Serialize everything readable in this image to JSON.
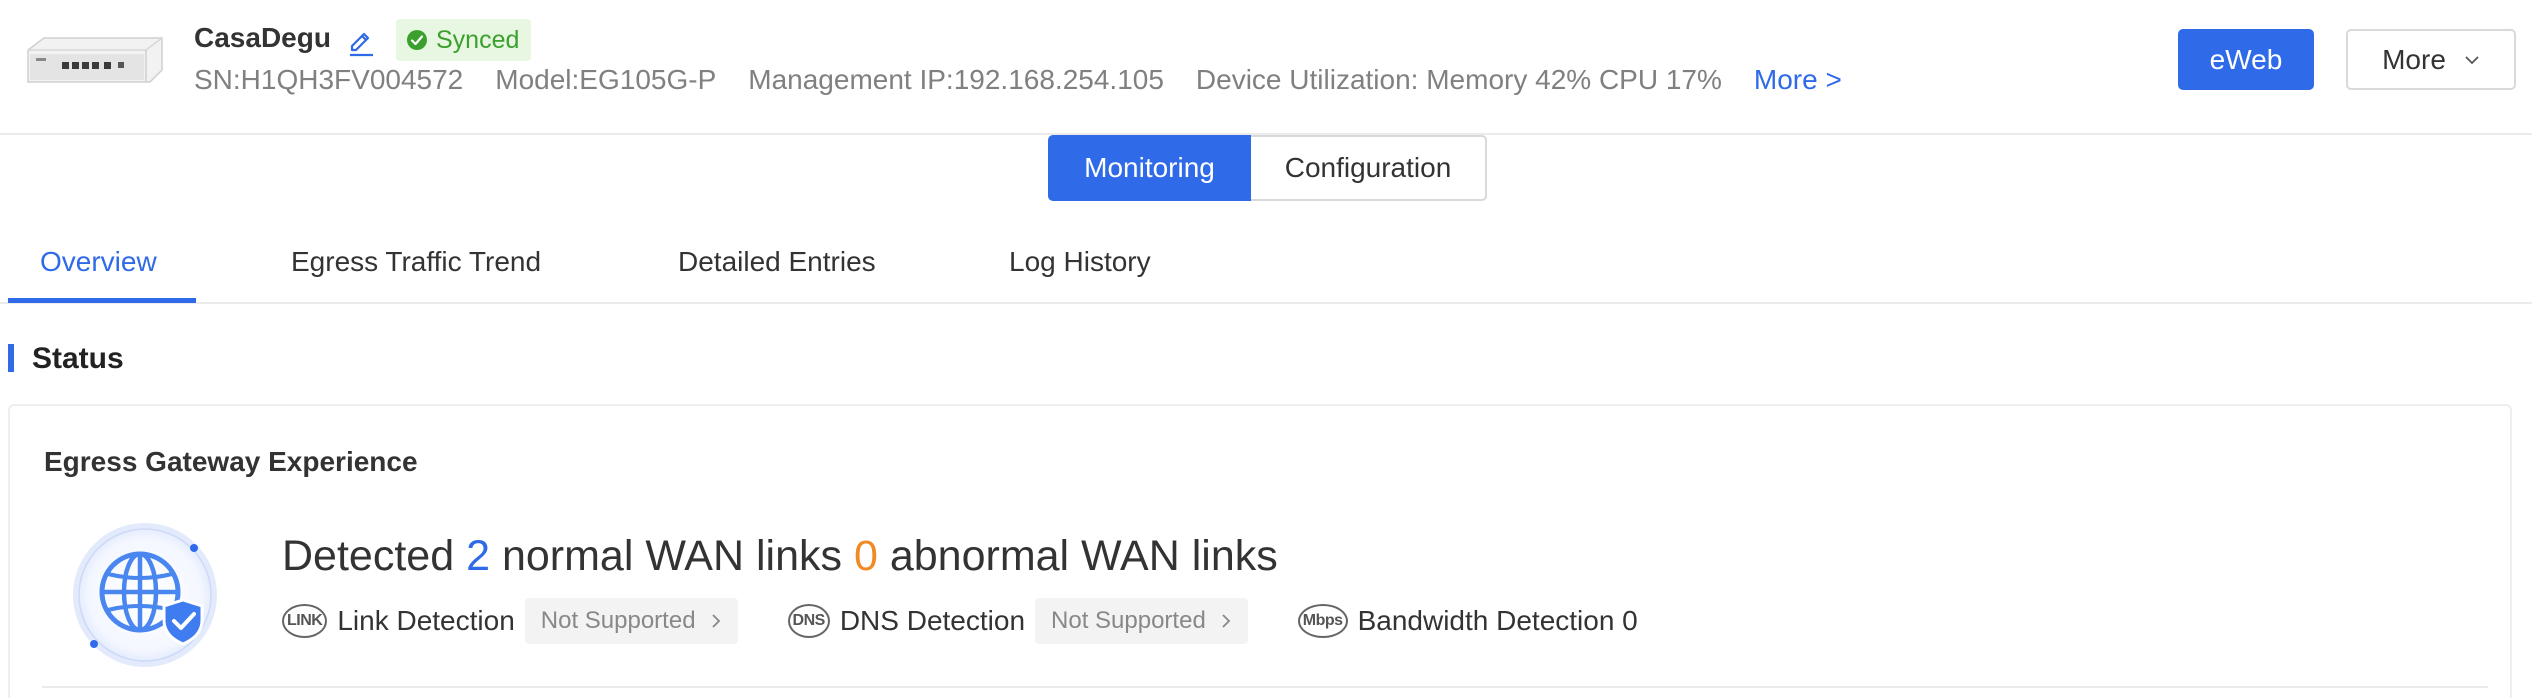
{
  "device": {
    "name": "CasaDegu",
    "sync_status": "Synced",
    "sn": "SN:H1QH3FV004572",
    "model": "Model:EG105G-P",
    "management_ip": "Management IP:192.168.254.105",
    "utilization": "Device Utilization: Memory 42% CPU 17%",
    "more_link": "More >"
  },
  "actions": {
    "eweb_label": "eWeb",
    "more_label": "More"
  },
  "segments": {
    "monitoring": "Monitoring",
    "configuration": "Configuration",
    "active": "Monitoring"
  },
  "tabs": {
    "items": [
      {
        "label": "Overview",
        "active": true
      },
      {
        "label": "Egress Traffic Trend",
        "active": false
      },
      {
        "label": "Detailed Entries",
        "active": false
      },
      {
        "label": "Log History",
        "active": false
      }
    ]
  },
  "status": {
    "section_title": "Status",
    "card_title": "Egress Gateway Experience",
    "headline": {
      "prefix": "Detected",
      "normal_count": "2",
      "normal_text": "normal WAN links",
      "abnormal_count": "0",
      "abnormal_text": "abnormal WAN links"
    },
    "detections": [
      {
        "icon": "LINK",
        "label": "Link Detection",
        "value": "Not Supported"
      },
      {
        "icon": "DNS",
        "label": "DNS Detection",
        "value": "Not Supported"
      },
      {
        "icon": "Mbps",
        "label": "Bandwidth Detection 0"
      }
    ]
  },
  "colors": {
    "accent": "#2f6ae8",
    "success": "#3ba02d",
    "warning": "#f08a24"
  }
}
